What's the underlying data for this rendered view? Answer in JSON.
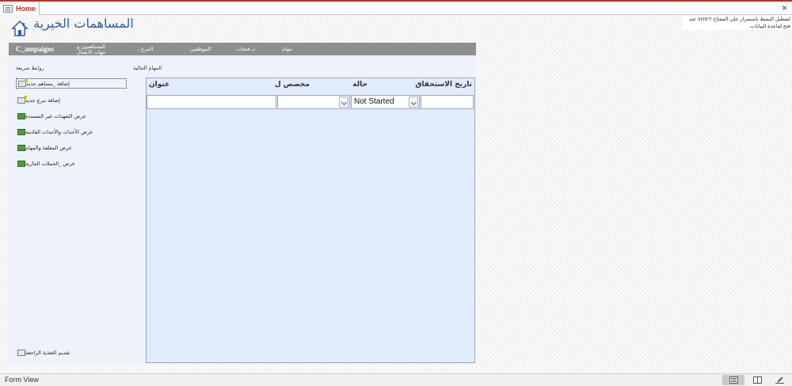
{
  "document_tab": {
    "label": "Home",
    "close_glyph": "×"
  },
  "header": {
    "title": "المساهمات الخيرية",
    "icon": "home-icon",
    "startup_note": "لتعطيل النشط باستمرار على المفتاح SHIFT عند فتح لقاعدة البيانات."
  },
  "navbar": {
    "items": [
      {
        "label": "C_ampaigns"
      },
      {
        "label": "المساهمون و جهات الاتصال"
      },
      {
        "label": "التبرع ـ"
      },
      {
        "label": "الموظفين"
      },
      {
        "label": "دـ فتحات"
      },
      {
        "label": "مهام"
      }
    ]
  },
  "quick_links": {
    "title": "روابط سريعة",
    "items": [
      {
        "label": "إضافة _مساهم جديد",
        "icon": "add-record-icon"
      },
      {
        "label": "إضافة تبرع جديد",
        "icon": "add-record-icon"
      },
      {
        "label": "عرض التعهدات غير المسددة",
        "icon": "report-icon"
      },
      {
        "label": "عرض الأحداث والأحداث القادمة",
        "icon": "report-icon"
      },
      {
        "label": "عرض المعلقة والمهام",
        "icon": "report-icon"
      },
      {
        "label": "عرض _الحملات الجارية",
        "icon": "report-icon"
      }
    ],
    "feedback": {
      "label": "تقديم التغذية الراجعة",
      "icon": "feedback-icon"
    }
  },
  "tasks": {
    "title": "المهام الحالية",
    "columns": {
      "due_date": "تاريخ الاستحقاق",
      "status": "حالة",
      "assigned_to": "مخصص ل",
      "title": "عنوان"
    },
    "new_row": {
      "due_date": "",
      "status": "Not Started",
      "assigned_to": "",
      "title": ""
    }
  },
  "statusbar": {
    "view_label": "Form View",
    "views": [
      "form-view-icon",
      "layout-view-icon",
      "design-view-icon"
    ]
  }
}
